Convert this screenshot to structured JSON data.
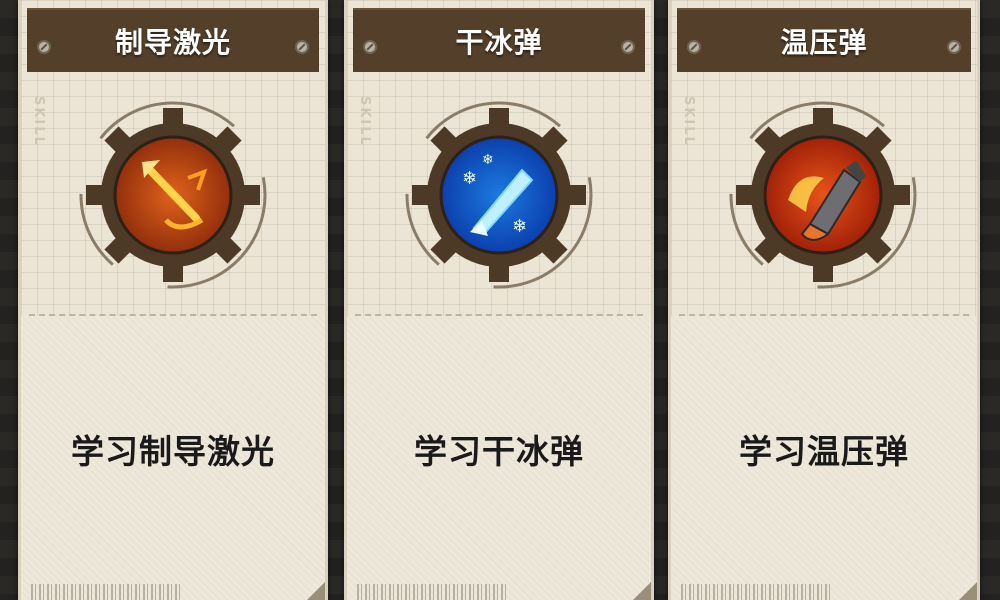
{
  "cards": [
    {
      "title": "制导激光",
      "skill_tag": "SKILL",
      "learn_label": "学习制导激光",
      "icon_name": "guided-laser-icon",
      "icon_colors": {
        "outer": "#8a2a0a",
        "inner": "#e2621c",
        "glow": "#ffd34a"
      }
    },
    {
      "title": "干冰弹",
      "skill_tag": "SKILL",
      "learn_label": "学习干冰弹",
      "icon_name": "dry-ice-bomb-icon",
      "icon_colors": {
        "outer": "#0a3aa8",
        "inner": "#1c7ae0",
        "glow": "#bff0ff"
      }
    },
    {
      "title": "温压弹",
      "skill_tag": "SKILL",
      "learn_label": "学习温压弹",
      "icon_name": "thermobaric-bomb-icon",
      "icon_colors": {
        "outer": "#9a1c06",
        "inner": "#e8541a",
        "glow": "#ffd24a"
      }
    }
  ],
  "colors": {
    "title_bar": "#54402a",
    "card_paper": "#ece5d6",
    "gear": "#4d3a26",
    "label_text": "#1a1a1a"
  }
}
